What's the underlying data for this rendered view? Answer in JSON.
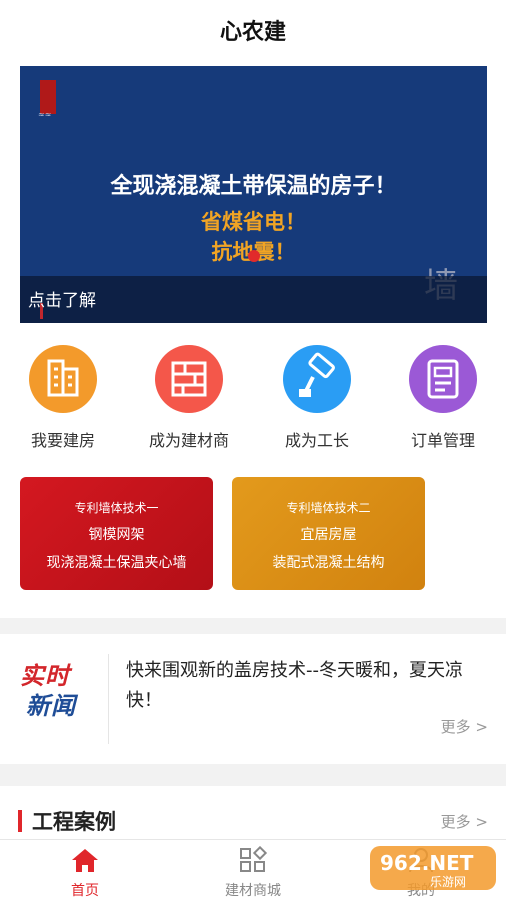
{
  "header": {
    "title": "心农建"
  },
  "banner": {
    "headline": "全现浇混凝土带保温的房子！",
    "sub1": "省煤省电！",
    "sub2": "抗地震！",
    "cta": "点击了解",
    "decor_char": "墙"
  },
  "quick_actions": [
    {
      "label": "我要建房",
      "icon": "building-icon",
      "color": "#f39a2b"
    },
    {
      "label": "成为建材商",
      "icon": "brick-wall-icon",
      "color": "#f4574a"
    },
    {
      "label": "成为工长",
      "icon": "paint-roller-icon",
      "color": "#2a9df4"
    },
    {
      "label": "订单管理",
      "icon": "order-list-icon",
      "color": "#9b59d6"
    }
  ],
  "tech_cards": [
    {
      "tag": "专利墙体技术一",
      "line1": "钢模网架",
      "line2": "现浇混凝土保温夹心墙",
      "color": "#c8131d"
    },
    {
      "tag": "专利墙体技术二",
      "line1": "宜居房屋",
      "line2": "装配式混凝土结构",
      "color": "#df8f17"
    }
  ],
  "news": {
    "logo_top": "实时",
    "logo_bottom": "新闻",
    "headline": "快来围观新的盖房技术--冬天暖和，夏天凉快！",
    "more": "更多 >"
  },
  "cases": {
    "title": "工程案例",
    "more": "更多 >"
  },
  "tabbar": {
    "items": [
      {
        "label": "首页",
        "icon": "home-icon",
        "active": true
      },
      {
        "label": "建材商城",
        "icon": "grid-shop-icon",
        "active": false
      },
      {
        "label": "我的",
        "icon": "user-icon",
        "active": false
      }
    ]
  },
  "watermark": {
    "text": "962.NET",
    "sub": "乐游网"
  },
  "colors": {
    "brand_red": "#e0262b",
    "banner_bg": "#163a7a",
    "accent_orange": "#f1a424"
  }
}
